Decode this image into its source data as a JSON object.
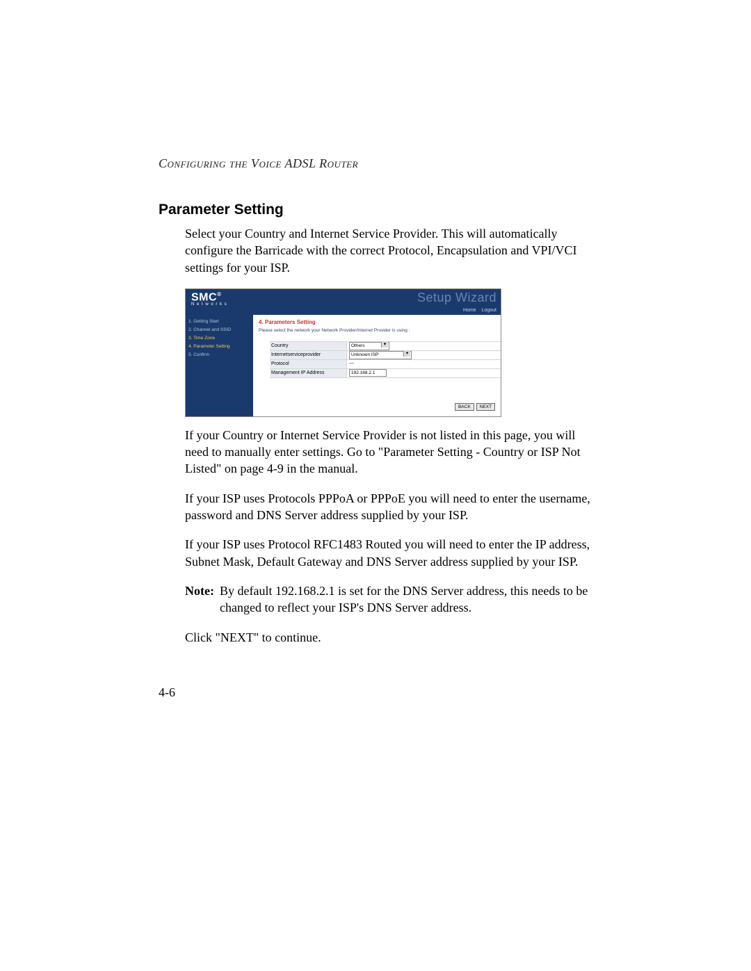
{
  "running_header": "Configuring the Voice ADSL Router",
  "section_title": "Parameter Setting",
  "paragraphs": {
    "p1": "Select your Country and Internet Service Provider. This will automatically configure the Barricade with the correct Protocol, Encapsulation and VPI/VCI settings for your ISP.",
    "p2": "If your Country or Internet Service Provider is not listed in this page, you will need to manually enter settings. Go to \"Parameter Setting - Country or ISP Not Listed\" on page 4-9 in the manual.",
    "p3": "If your ISP uses Protocols PPPoA or PPPoE you will need to enter the username, password and DNS Server address supplied by your ISP.",
    "p4": "If your ISP uses Protocol RFC1483 Routed you will need to enter the IP address, Subnet Mask, Default Gateway and DNS Server address supplied by your ISP.",
    "p5": "Click \"NEXT\" to continue."
  },
  "note": {
    "label": "Note:",
    "text": "By default 192.168.2.1 is set for the DNS Server address, this needs to be changed to reflect your ISP's DNS Server address."
  },
  "page_number": "4-6",
  "screenshot": {
    "logo_main": "SMC",
    "logo_reg": "®",
    "logo_sub": "N e t w o r k s",
    "setup_title": "Setup Wizard",
    "toplinks": {
      "home": "Home",
      "logout": "Logout"
    },
    "sidebar": [
      {
        "label": "1. Getting Start",
        "active": false
      },
      {
        "label": "2. Channel and SSID",
        "active": false
      },
      {
        "label": "3. Time Zone",
        "active": true
      },
      {
        "label": "4. Parameter Setting",
        "active": true
      },
      {
        "label": "5. Confirm",
        "active": false
      }
    ],
    "main_title": "4. Parameters Setting",
    "main_instr": "Please select the network your Network Provider/Internet Provider is using :",
    "form": {
      "country_label": "Country",
      "country_value": "Others",
      "isp_label": "Internetserviceprovider",
      "isp_value": "Unknown ISP",
      "protocol_label": "Protocol",
      "protocol_value": "---",
      "mgmt_label": "Management IP Address",
      "mgmt_value": "192.168.2.1"
    },
    "buttons": {
      "back": "BACK",
      "next": "NEXT"
    }
  }
}
